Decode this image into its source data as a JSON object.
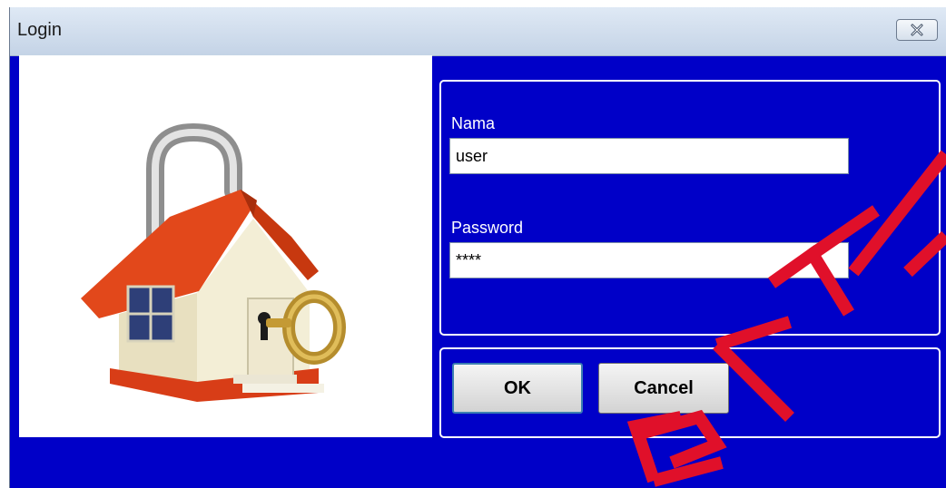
{
  "window": {
    "title": "Login",
    "close_icon": "close-icon"
  },
  "illustration": {
    "icon": "house-lock-key-icon"
  },
  "form": {
    "name_label": "Nama",
    "name_value": "user",
    "password_label": "Password",
    "password_value": "****"
  },
  "buttons": {
    "ok_label": "OK",
    "cancel_label": "Cancel"
  },
  "watermark": {
    "text": "BAYA"
  },
  "colors": {
    "background": "#0000c8",
    "panel": "#ffffff",
    "watermark": "#e0102a",
    "roof": "#e2481b",
    "wall": "#f3eed6"
  }
}
